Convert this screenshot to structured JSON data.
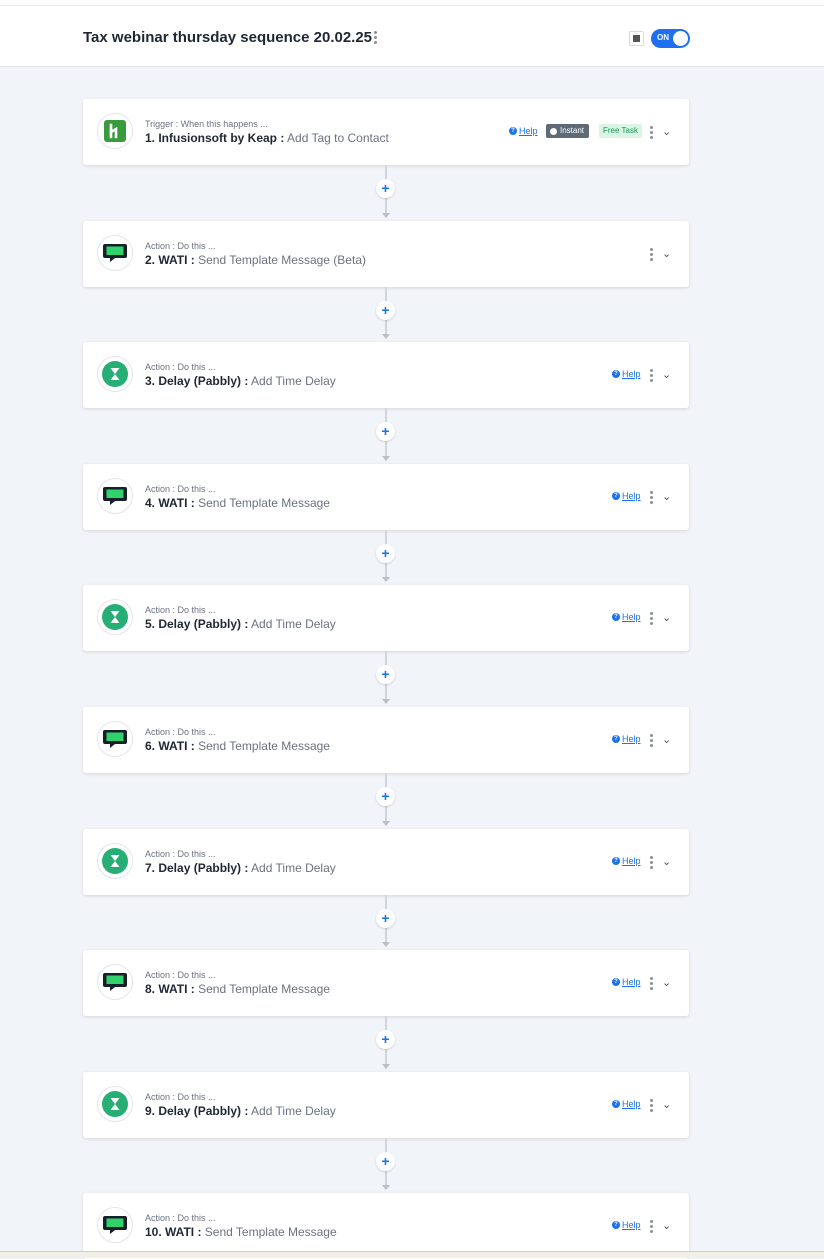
{
  "header": {
    "title": "Tax webinar thursday sequence 20.02.25",
    "toggle_label": "ON"
  },
  "steps": [
    {
      "type_label": "Trigger : When this happens ...",
      "app": "1. Infusionsoft by Keap :",
      "event": " Add Tag to Contact",
      "icon": "keap-icon",
      "help": "Help",
      "instant": "Instant",
      "free_task": "Free Task"
    },
    {
      "type_label": "Action : Do this ...",
      "app": "2. WATI :",
      "event": " Send Template Message (Beta)",
      "icon": "chat-bubble-icon"
    },
    {
      "type_label": "Action : Do this ...",
      "app": "3. Delay (Pabbly) :",
      "event": " Add Time Delay",
      "icon": "hourglass-icon",
      "help": "Help"
    },
    {
      "type_label": "Action : Do this ...",
      "app": "4. WATI :",
      "event": " Send Template Message",
      "icon": "chat-bubble-icon",
      "help": "Help"
    },
    {
      "type_label": "Action : Do this ...",
      "app": "5. Delay (Pabbly) :",
      "event": " Add Time Delay",
      "icon": "hourglass-icon",
      "help": "Help"
    },
    {
      "type_label": "Action : Do this ...",
      "app": "6. WATI :",
      "event": " Send Template Message",
      "icon": "chat-bubble-icon",
      "help": "Help"
    },
    {
      "type_label": "Action : Do this ...",
      "app": "7. Delay (Pabbly) :",
      "event": " Add Time Delay",
      "icon": "hourglass-icon",
      "help": "Help"
    },
    {
      "type_label": "Action : Do this ...",
      "app": "8. WATI :",
      "event": " Send Template Message",
      "icon": "chat-bubble-icon",
      "help": "Help"
    },
    {
      "type_label": "Action : Do this ...",
      "app": "9. Delay (Pabbly) :",
      "event": " Add Time Delay",
      "icon": "hourglass-icon",
      "help": "Help"
    },
    {
      "type_label": "Action : Do this ...",
      "app": "10. WATI :",
      "event": " Send Template Message",
      "icon": "chat-bubble-icon",
      "help": "Help"
    }
  ],
  "colors": {
    "accent": "#1a73e8",
    "toggle_on": "#1f6ff2",
    "keap_green": "#3a9b3e",
    "wati_green": "#2fd26b",
    "delay_green": "#27ae74"
  }
}
